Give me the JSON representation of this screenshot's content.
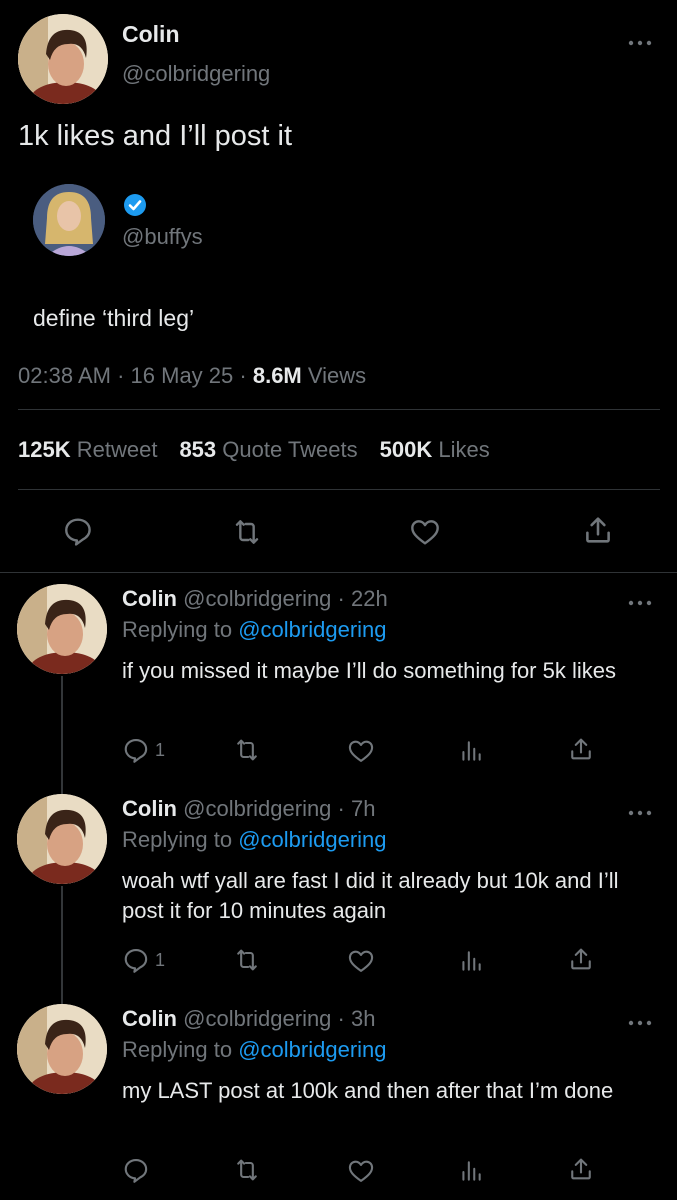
{
  "main_tweet": {
    "author_name": "Colin",
    "author_handle": "@colbridgering",
    "text": "1k likes and I’ll post it",
    "quoted": {
      "handle": "@buffys",
      "text": "define ‘third leg’"
    },
    "meta": {
      "time": "02:38 AM",
      "sep1": "·",
      "date": "16 May 25",
      "sep2": "·",
      "views_count": "8.6M",
      "views_label": "Views"
    },
    "stats": {
      "retweets_count": "125K",
      "retweets_label": "Retweet",
      "quotes_count": "853",
      "quotes_label": "Quote Tweets",
      "likes_count": "500K",
      "likes_label": "Likes"
    }
  },
  "replies": [
    {
      "name": "Colin",
      "handle": "@colbridgering",
      "dot": "·",
      "time": "22h",
      "replying_label": "Replying to",
      "replying_to": "@colbridgering",
      "text": "if you missed it maybe I’ll do something for 5k likes",
      "reply_count": "1"
    },
    {
      "name": "Colin",
      "handle": "@colbridgering",
      "dot": "·",
      "time": "7h",
      "replying_label": "Replying to",
      "replying_to": "@colbridgering",
      "text": "woah wtf yall are fast I did it already but 10k and I’ll post it for 10 minutes again",
      "reply_count": "1"
    },
    {
      "name": "Colin",
      "handle": "@colbridgering",
      "dot": "·",
      "time": "3h",
      "replying_label": "Replying to",
      "replying_to": "@colbridgering",
      "text": "my LAST post at 100k and then after that I’m done",
      "reply_count": ""
    }
  ],
  "icons": {
    "more": "more-options-icon",
    "reply": "reply-icon",
    "retweet": "retweet-icon",
    "like": "heart-icon",
    "share": "share-icon",
    "views": "views-icon",
    "verified": "verified-badge-icon"
  },
  "colors": {
    "background": "#000000",
    "text": "#e7e9ea",
    "muted": "#71767b",
    "link": "#1d9bf0",
    "divider": "#2f3336"
  }
}
